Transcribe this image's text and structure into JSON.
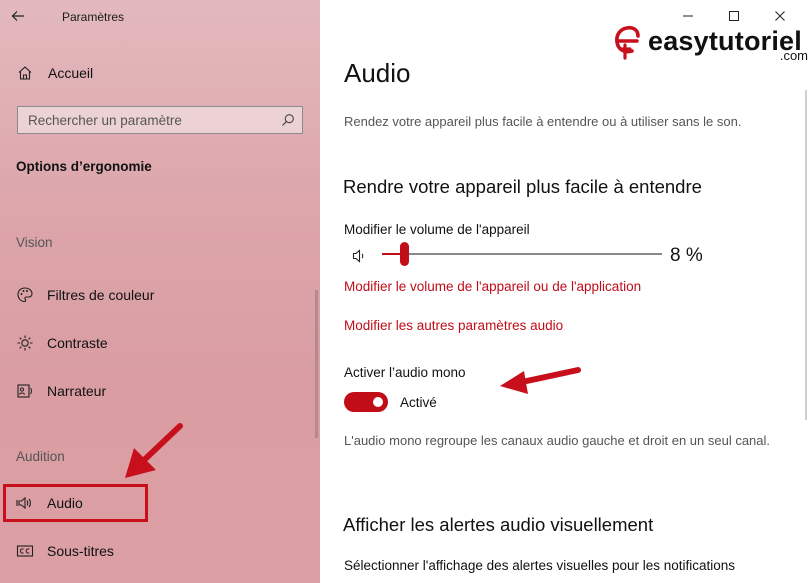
{
  "window": {
    "title": "Paramètres",
    "back_icon": "back-arrow-icon",
    "minimize_icon": "minimize-icon",
    "maximize_icon": "maximize-icon",
    "close_icon": "close-icon"
  },
  "sidebar": {
    "home": {
      "label": "Accueil",
      "icon": "home-icon"
    },
    "search": {
      "placeholder": "Rechercher un paramètre",
      "icon": "search-icon"
    },
    "section_title": "Options d’ergonomie",
    "groups": [
      {
        "label": "Vision",
        "items": [
          {
            "label": "Filtres de couleur",
            "icon": "color-filter-icon"
          },
          {
            "label": "Contraste",
            "icon": "contrast-icon"
          },
          {
            "label": "Narrateur",
            "icon": "narrator-icon"
          }
        ]
      },
      {
        "label": "Audition",
        "items": [
          {
            "label": "Audio",
            "icon": "audio-icon",
            "selected": true
          },
          {
            "label": "Sous-titres",
            "icon": "closed-captions-icon"
          }
        ]
      }
    ]
  },
  "content": {
    "title": "Audio",
    "description": "Rendez votre appareil plus facile à entendre ou à utiliser sans le son.",
    "section1_title": "Rendre votre appareil plus facile à entendre",
    "volume_label": "Modifier le volume de l'appareil",
    "volume": {
      "value": 8,
      "display": "8 %"
    },
    "link_app_volume": "Modifier le volume de l'appareil ou de l'application",
    "link_other_audio": "Modifier les autres paramètres audio",
    "mono_label": "Activer l’audio mono",
    "mono_state": "Activé",
    "mono_description": "L'audio mono regroupe les canaux audio gauche et droit en un seul canal.",
    "section2_title": "Afficher les alertes audio visuellement",
    "notif_label": "Sélectionner l'affichage des alertes visuelles pour les notifications"
  },
  "watermark": {
    "name": "easytutoriel",
    "tld": ".com"
  },
  "colors": {
    "accent": "#c10d18",
    "highlight": "#c8101c",
    "sidebar_bg": "#dca6ab"
  }
}
